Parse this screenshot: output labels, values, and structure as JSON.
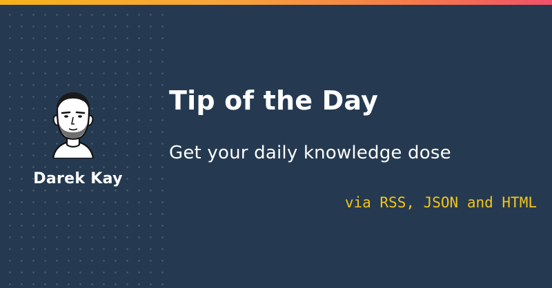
{
  "colors": {
    "background": "#253a51",
    "accent_gradient": [
      "#f5b21a",
      "#f0506a"
    ],
    "formats_text": "#f5c518",
    "text": "#ffffff"
  },
  "author": {
    "name": "Darek Kay",
    "avatar_icon": "avatar-portrait"
  },
  "headline": {
    "title": "Tip of the Day",
    "subtitle": "Get your daily knowledge dose",
    "formats": "via RSS, JSON and HTML"
  }
}
